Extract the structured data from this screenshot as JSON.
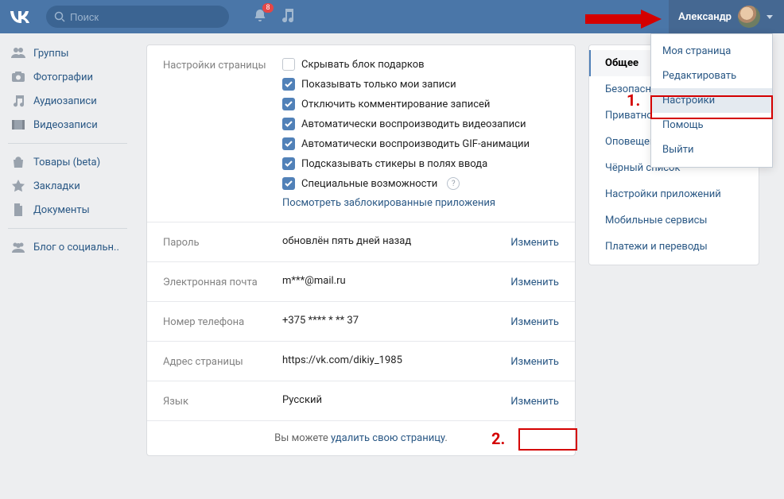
{
  "header": {
    "search_placeholder": "Поиск",
    "notif_count": "8",
    "username": "Александр"
  },
  "sidebar": {
    "items": [
      {
        "label": "Группы",
        "icon": "users"
      },
      {
        "label": "Фотографии",
        "icon": "camera"
      },
      {
        "label": "Аудиозаписи",
        "icon": "music"
      },
      {
        "label": "Видеозаписи",
        "icon": "video"
      }
    ],
    "items2": [
      {
        "label": "Товары (beta)",
        "icon": "bag"
      },
      {
        "label": "Закладки",
        "icon": "star"
      },
      {
        "label": "Документы",
        "icon": "doc"
      }
    ],
    "items3": [
      {
        "label": "Блог о социальн..",
        "icon": "group"
      }
    ]
  },
  "page_settings": {
    "section_label": "Настройки страницы",
    "checks": [
      {
        "label": "Скрывать блок подарков",
        "checked": false,
        "help": false
      },
      {
        "label": "Показывать только мои записи",
        "checked": true,
        "help": false
      },
      {
        "label": "Отключить комментирование записей",
        "checked": true,
        "help": false
      },
      {
        "label": "Автоматически воспроизводить видеозаписи",
        "checked": true,
        "help": false
      },
      {
        "label": "Автоматически воспроизводить GIF-анимации",
        "checked": true,
        "help": false
      },
      {
        "label": "Подсказывать стикеры в полях ввода",
        "checked": true,
        "help": false
      },
      {
        "label": "Специальные возможности",
        "checked": true,
        "help": true
      }
    ],
    "blocked_link": "Посмотреть заблокированные приложения"
  },
  "rows": {
    "password": {
      "label": "Пароль",
      "value": "обновлён пять дней назад",
      "action": "Изменить"
    },
    "email": {
      "label": "Электронная почта",
      "value": "m***@mail.ru",
      "action": "Изменить"
    },
    "phone": {
      "label": "Номер телефона",
      "value": "+375 **** * ** 37",
      "action": "Изменить"
    },
    "address": {
      "label": "Адрес страницы",
      "value": "https://vk.com/dikiy_1985",
      "action": "Изменить"
    },
    "language": {
      "label": "Язык",
      "value": "Русский",
      "action": "Изменить"
    }
  },
  "footer": {
    "prefix": "Вы можете ",
    "link": "удалить свою страницу",
    "suffix": "."
  },
  "right_nav": {
    "items": [
      {
        "label": "Общее",
        "active": true
      },
      {
        "label": "Безопасность",
        "active": false
      },
      {
        "label": "Приватность",
        "active": false
      },
      {
        "label": "Оповещения",
        "active": false
      },
      {
        "label": "Чёрный список",
        "active": false
      },
      {
        "label": "Настройки приложений",
        "active": false
      },
      {
        "label": "Мобильные сервисы",
        "active": false
      },
      {
        "label": "Платежи и переводы",
        "active": false
      }
    ]
  },
  "user_menu": {
    "items": [
      {
        "label": "Моя страница",
        "hl": false
      },
      {
        "label": "Редактировать",
        "hl": false
      },
      {
        "label": "Настройки",
        "hl": true
      },
      {
        "label": "Помощь",
        "hl": false
      },
      {
        "label": "Выйти",
        "hl": false
      }
    ]
  },
  "annotations": {
    "num1": "1.",
    "num2": "2."
  }
}
